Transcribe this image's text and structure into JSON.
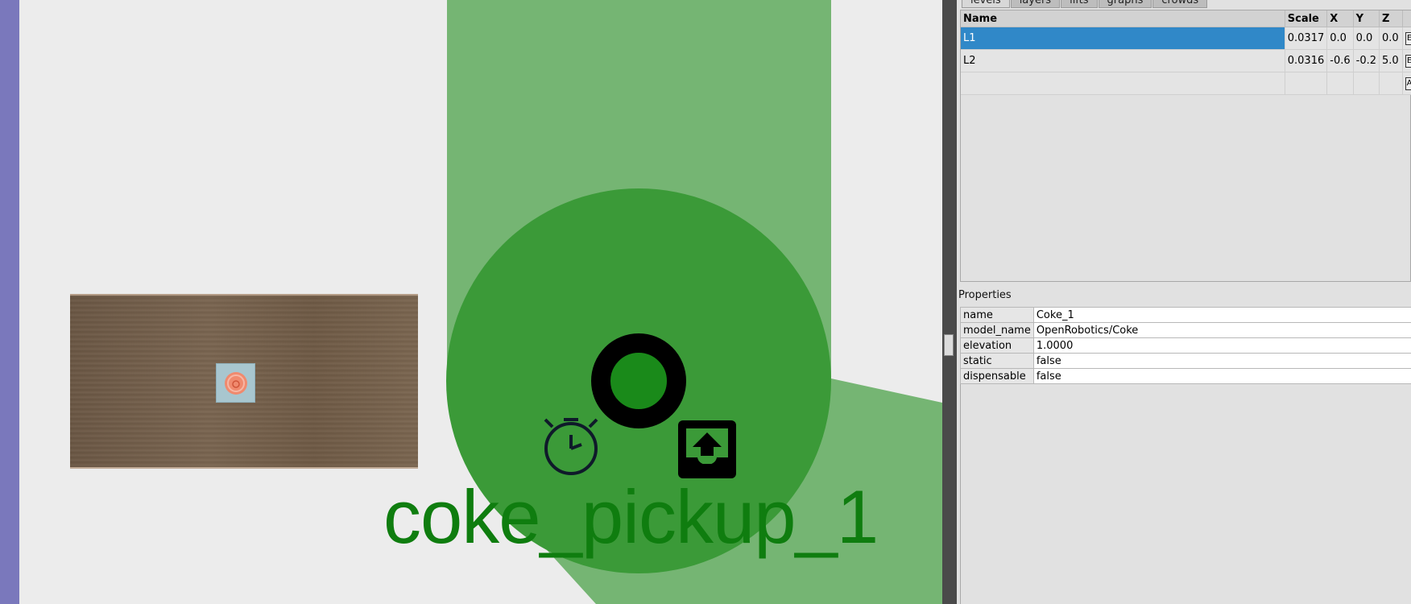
{
  "canvas": {
    "vertex_label": "coke_pickup_1",
    "colors": {
      "vertex_zone": "#75b573",
      "vertex_circle": "#3b9a38",
      "vertex_label": "#0f7d0f",
      "left_strip": "#7a78bc",
      "selection": "#3088c8"
    },
    "icons": [
      "ring-icon",
      "stopwatch-icon",
      "dispenser-icon",
      "coke-can-icon"
    ]
  },
  "tabs": [
    "levels",
    "layers",
    "lifts",
    "graphs",
    "crowds"
  ],
  "levels": {
    "columns": [
      "Name",
      "Scale",
      "X",
      "Y",
      "Z"
    ],
    "rows": [
      {
        "name": "L1",
        "scale": "0.0317",
        "x": "0.0",
        "y": "0.0",
        "z": "0.0",
        "btn": "E",
        "selected": true
      },
      {
        "name": "L2",
        "scale": "0.0316",
        "x": "-0.6",
        "y": "-0.2",
        "z": "5.0",
        "btn": "E",
        "selected": false
      },
      {
        "name": "",
        "scale": "",
        "x": "",
        "y": "",
        "z": "",
        "btn": "A",
        "selected": false
      }
    ]
  },
  "properties": {
    "title": "Properties",
    "rows": [
      {
        "key": "name",
        "value": "Coke_1"
      },
      {
        "key": "model_name",
        "value": "OpenRobotics/Coke"
      },
      {
        "key": "elevation",
        "value": "1.0000"
      },
      {
        "key": "static",
        "value": "false"
      },
      {
        "key": "dispensable",
        "value": "false"
      }
    ]
  }
}
